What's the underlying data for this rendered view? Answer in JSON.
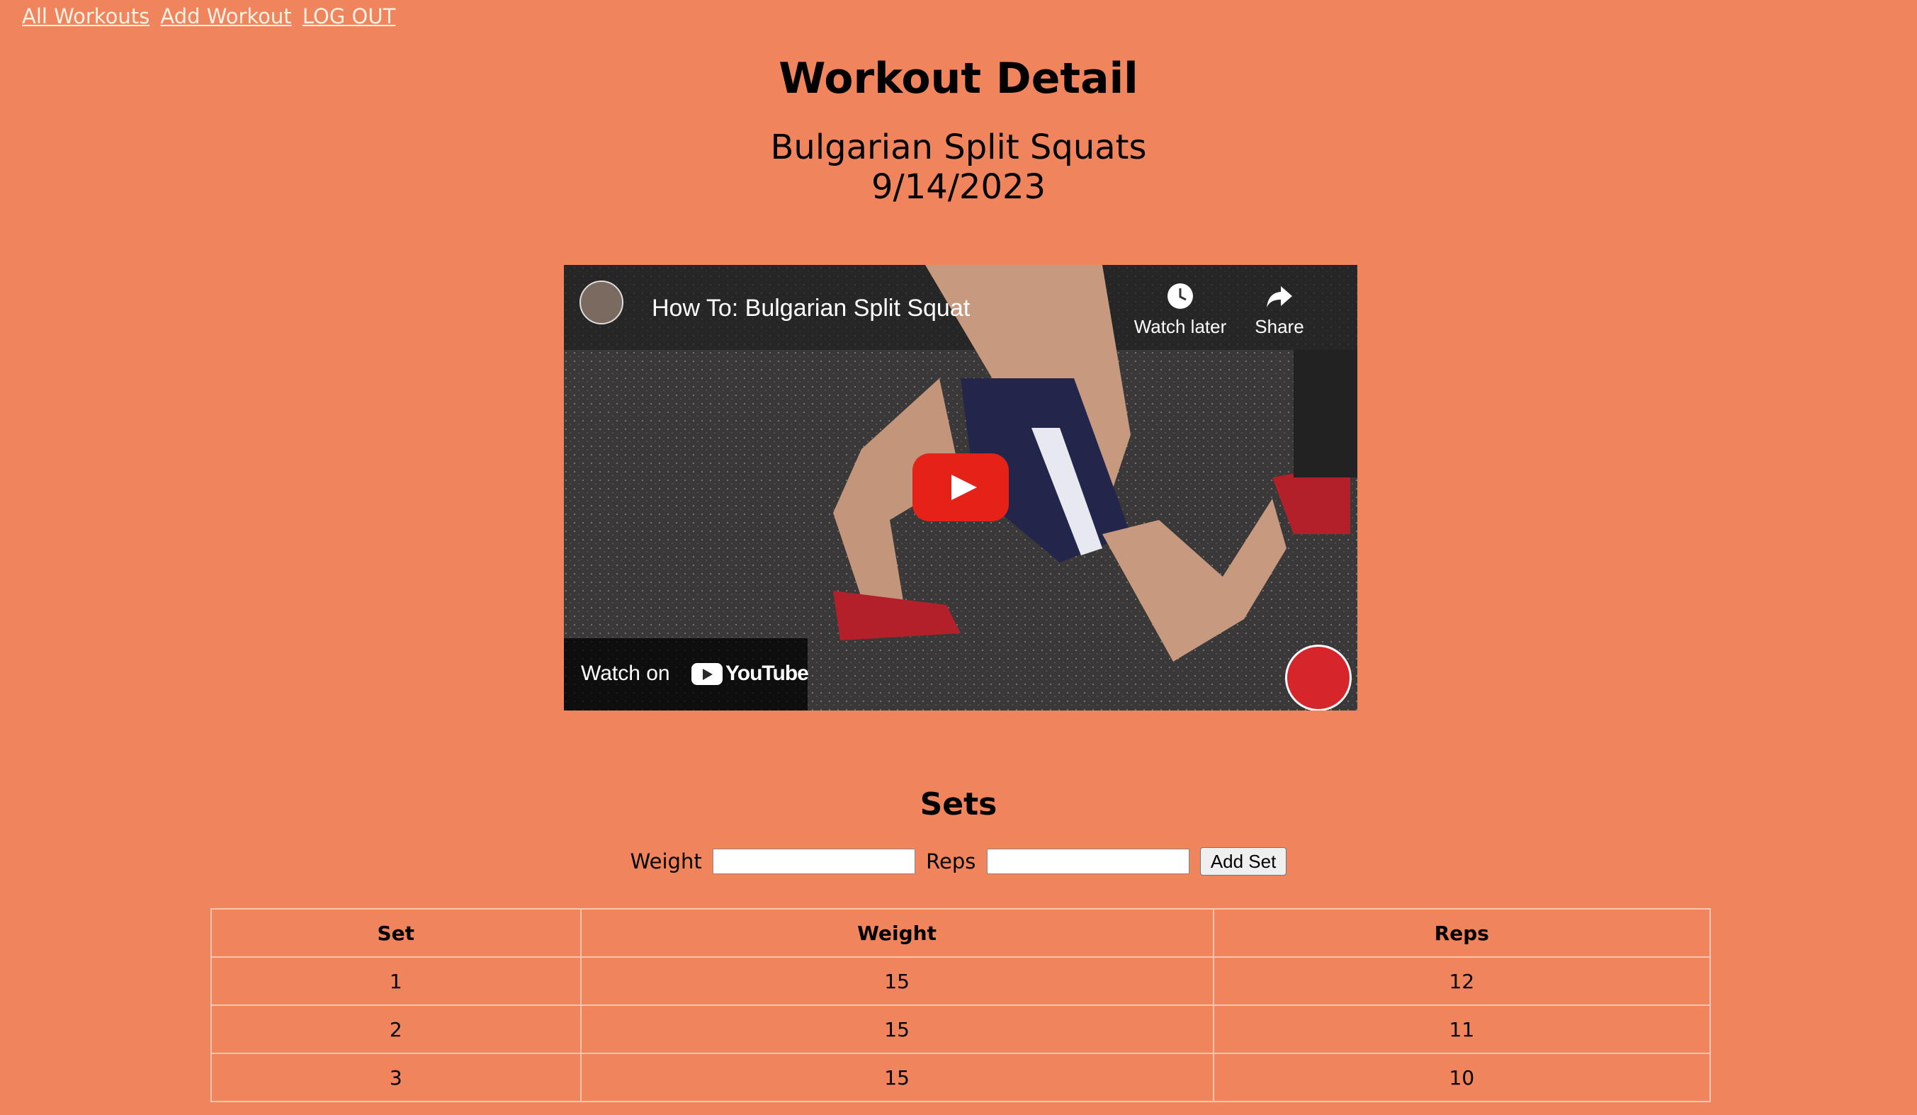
{
  "nav": {
    "links": [
      "All Workouts",
      "Add Workout",
      "LOG OUT"
    ]
  },
  "header": {
    "title": "Workout Detail",
    "exercise": "Bulgarian Split Squats",
    "date": "9/14/2023"
  },
  "video": {
    "title": "How To: Bulgarian Split Squat",
    "watch_later_label": "Watch later",
    "share_label": "Share",
    "watch_on_label": "Watch on",
    "youtube_label": "YouTube",
    "icons": [
      "clock-icon",
      "share-icon",
      "play-icon",
      "youtube-icon"
    ]
  },
  "sets": {
    "title": "Sets",
    "weight_label": "Weight",
    "reps_label": "Reps",
    "weight_value": "",
    "reps_value": "",
    "add_button_label": "Add Set",
    "columns": [
      "Set",
      "Weight",
      "Reps"
    ],
    "rows": [
      {
        "set": "1",
        "weight": "15",
        "reps": "12"
      },
      {
        "set": "2",
        "weight": "15",
        "reps": "11"
      },
      {
        "set": "3",
        "weight": "15",
        "reps": "10"
      }
    ]
  },
  "colors": {
    "background": "#f0845c",
    "link": "#fff2e6",
    "youtube_red": "#e62117"
  }
}
